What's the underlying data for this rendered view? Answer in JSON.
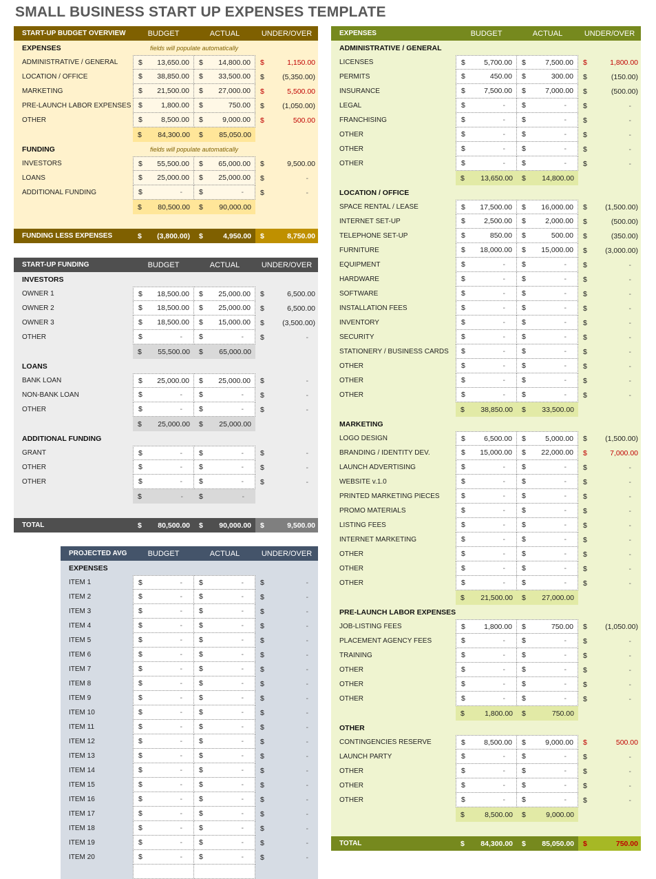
{
  "title": "SMALL BUSINESS START UP EXPENSES TEMPLATE",
  "colors": {
    "overview_header": "#7f6000",
    "overview_bg": "#fff2cc",
    "overview_subtotal": "#ffe699",
    "overview_highlight": "#bf9000",
    "funding_header": "#4f4f4f",
    "funding_bg": "#ededed",
    "funding_subtotal": "#d9d9d9",
    "funding_highlight": "#7f7f7f",
    "projected_header": "#44546a",
    "projected_bg": "#d6dce4",
    "expenses_header": "#76891e",
    "expenses_bg": "#eff4d0",
    "expenses_subtotal": "#e2eaa6",
    "expenses_highlight": "#a6b825",
    "negative_red": "#c00000"
  },
  "columns": {
    "budget": "BUDGET",
    "actual": "ACTUAL",
    "under_over": "UNDER/OVER"
  },
  "overview": {
    "header": "START-UP BUDGET OVERVIEW",
    "note": "fields will populate automatically",
    "expenses_label": "EXPENSES",
    "expenses": [
      {
        "label": "ADMINISTRATIVE / GENERAL",
        "budget": "13,650.00",
        "actual": "14,800.00",
        "diff": "1,150.00",
        "over": true
      },
      {
        "label": "LOCATION / OFFICE",
        "budget": "38,850.00",
        "actual": "33,500.00",
        "diff": "(5,350.00)",
        "over": false
      },
      {
        "label": "MARKETING",
        "budget": "21,500.00",
        "actual": "27,000.00",
        "diff": "5,500.00",
        "over": true
      },
      {
        "label": "PRE-LAUNCH LABOR EXPENSES",
        "budget": "1,800.00",
        "actual": "750.00",
        "diff": "(1,050.00)",
        "over": false
      },
      {
        "label": "OTHER",
        "budget": "8,500.00",
        "actual": "9,000.00",
        "diff": "500.00",
        "over": true
      }
    ],
    "expenses_total": {
      "budget": "84,300.00",
      "actual": "85,050.00"
    },
    "funding_label": "FUNDING",
    "funding": [
      {
        "label": "INVESTORS",
        "budget": "55,500.00",
        "actual": "65,000.00",
        "diff": "9,500.00",
        "over": false
      },
      {
        "label": "LOANS",
        "budget": "25,000.00",
        "actual": "25,000.00",
        "diff": "-",
        "over": false
      },
      {
        "label": "ADDITIONAL FUNDING",
        "budget": "-",
        "actual": "-",
        "diff": "-",
        "over": false
      }
    ],
    "funding_total": {
      "budget": "80,500.00",
      "actual": "90,000.00"
    },
    "footer": {
      "label": "FUNDING LESS EXPENSES",
      "budget": "(3,800.00)",
      "actual": "4,950.00",
      "diff": "8,750.00"
    }
  },
  "startup_funding": {
    "header": "START-UP FUNDING",
    "sections": [
      {
        "label": "INVESTORS",
        "rows": [
          {
            "label": "OWNER 1",
            "budget": "18,500.00",
            "actual": "25,000.00",
            "diff": "6,500.00"
          },
          {
            "label": "OWNER 2",
            "budget": "18,500.00",
            "actual": "25,000.00",
            "diff": "6,500.00"
          },
          {
            "label": "OWNER 3",
            "budget": "18,500.00",
            "actual": "15,000.00",
            "diff": "(3,500.00)"
          },
          {
            "label": "OTHER",
            "budget": "-",
            "actual": "-",
            "diff": "-"
          }
        ],
        "total": {
          "budget": "55,500.00",
          "actual": "65,000.00"
        }
      },
      {
        "label": "LOANS",
        "rows": [
          {
            "label": "BANK LOAN",
            "budget": "25,000.00",
            "actual": "25,000.00",
            "diff": "-"
          },
          {
            "label": "NON-BANK LOAN",
            "budget": "-",
            "actual": "-",
            "diff": "-"
          },
          {
            "label": "OTHER",
            "budget": "-",
            "actual": "-",
            "diff": "-"
          }
        ],
        "total": {
          "budget": "25,000.00",
          "actual": "25,000.00"
        }
      },
      {
        "label": "ADDITIONAL FUNDING",
        "rows": [
          {
            "label": "GRANT",
            "budget": "-",
            "actual": "-",
            "diff": "-"
          },
          {
            "label": "OTHER",
            "budget": "-",
            "actual": "-",
            "diff": "-"
          },
          {
            "label": "OTHER",
            "budget": "-",
            "actual": "-",
            "diff": "-"
          }
        ],
        "total": {
          "budget": "-",
          "actual": "-"
        }
      }
    ],
    "footer": {
      "label": "TOTAL",
      "budget": "80,500.00",
      "actual": "90,000.00",
      "diff": "9,500.00"
    }
  },
  "projected": {
    "header": "PROJECTED AVG",
    "expenses_label": "EXPENSES",
    "items": [
      "ITEM 1",
      "ITEM 2",
      "ITEM 3",
      "ITEM 4",
      "ITEM 5",
      "ITEM 6",
      "ITEM 7",
      "ITEM 8",
      "ITEM 9",
      "ITEM 10",
      "ITEM 11",
      "ITEM 12",
      "ITEM 13",
      "ITEM 14",
      "ITEM 15",
      "ITEM 16",
      "ITEM 17",
      "ITEM 18",
      "ITEM 19",
      "ITEM 20"
    ],
    "empty_value": "-"
  },
  "expenses": {
    "header": "EXPENSES",
    "sections": [
      {
        "label": "ADMINISTRATIVE / GENERAL",
        "rows": [
          {
            "label": "LICENSES",
            "budget": "5,700.00",
            "actual": "7,500.00",
            "diff": "1,800.00",
            "over": true
          },
          {
            "label": "PERMITS",
            "budget": "450.00",
            "actual": "300.00",
            "diff": "(150.00)"
          },
          {
            "label": "INSURANCE",
            "budget": "7,500.00",
            "actual": "7,000.00",
            "diff": "(500.00)"
          },
          {
            "label": "LEGAL",
            "budget": "-",
            "actual": "-",
            "diff": "-"
          },
          {
            "label": "FRANCHISING",
            "budget": "-",
            "actual": "-",
            "diff": "-"
          },
          {
            "label": "OTHER",
            "budget": "-",
            "actual": "-",
            "diff": "-"
          },
          {
            "label": "OTHER",
            "budget": "-",
            "actual": "-",
            "diff": "-"
          },
          {
            "label": "OTHER",
            "budget": "-",
            "actual": "-",
            "diff": "-"
          }
        ],
        "total": {
          "budget": "13,650.00",
          "actual": "14,800.00"
        }
      },
      {
        "label": "LOCATION / OFFICE",
        "rows": [
          {
            "label": "SPACE RENTAL / LEASE",
            "budget": "17,500.00",
            "actual": "16,000.00",
            "diff": "(1,500.00)"
          },
          {
            "label": "INTERNET SET-UP",
            "budget": "2,500.00",
            "actual": "2,000.00",
            "diff": "(500.00)"
          },
          {
            "label": "TELEPHONE SET-UP",
            "budget": "850.00",
            "actual": "500.00",
            "diff": "(350.00)"
          },
          {
            "label": "FURNITURE",
            "budget": "18,000.00",
            "actual": "15,000.00",
            "diff": "(3,000.00)"
          },
          {
            "label": "EQUIPMENT",
            "budget": "-",
            "actual": "-",
            "diff": "-"
          },
          {
            "label": "HARDWARE",
            "budget": "-",
            "actual": "-",
            "diff": "-"
          },
          {
            "label": "SOFTWARE",
            "budget": "-",
            "actual": "-",
            "diff": "-"
          },
          {
            "label": "INSTALLATION FEES",
            "budget": "-",
            "actual": "-",
            "diff": "-"
          },
          {
            "label": "INVENTORY",
            "budget": "-",
            "actual": "-",
            "diff": "-"
          },
          {
            "label": "SECURITY",
            "budget": "-",
            "actual": "-",
            "diff": "-"
          },
          {
            "label": "STATIONERY / BUSINESS CARDS",
            "budget": "-",
            "actual": "-",
            "diff": "-"
          },
          {
            "label": "OTHER",
            "budget": "-",
            "actual": "-",
            "diff": "-"
          },
          {
            "label": "OTHER",
            "budget": "-",
            "actual": "-",
            "diff": "-"
          },
          {
            "label": "OTHER",
            "budget": "-",
            "actual": "-",
            "diff": "-"
          }
        ],
        "total": {
          "budget": "38,850.00",
          "actual": "33,500.00"
        }
      },
      {
        "label": "MARKETING",
        "rows": [
          {
            "label": "LOGO DESIGN",
            "budget": "6,500.00",
            "actual": "5,000.00",
            "diff": "(1,500.00)"
          },
          {
            "label": "BRANDING / IDENTITY DEV.",
            "budget": "15,000.00",
            "actual": "22,000.00",
            "diff": "7,000.00",
            "over": true
          },
          {
            "label": "LAUNCH ADVERTISING",
            "budget": "-",
            "actual": "-",
            "diff": "-"
          },
          {
            "label": "WEBSITE v.1.0",
            "budget": "-",
            "actual": "-",
            "diff": "-"
          },
          {
            "label": "PRINTED MARKETING PIECES",
            "budget": "-",
            "actual": "-",
            "diff": "-"
          },
          {
            "label": "PROMO MATERIALS",
            "budget": "-",
            "actual": "-",
            "diff": "-"
          },
          {
            "label": "LISTING FEES",
            "budget": "-",
            "actual": "-",
            "diff": "-"
          },
          {
            "label": "INTERNET MARKETING",
            "budget": "-",
            "actual": "-",
            "diff": "-"
          },
          {
            "label": "OTHER",
            "budget": "-",
            "actual": "-",
            "diff": "-"
          },
          {
            "label": "OTHER",
            "budget": "-",
            "actual": "-",
            "diff": "-"
          },
          {
            "label": "OTHER",
            "budget": "-",
            "actual": "-",
            "diff": "-"
          }
        ],
        "total": {
          "budget": "21,500.00",
          "actual": "27,000.00"
        }
      },
      {
        "label": "PRE-LAUNCH LABOR EXPENSES",
        "rows": [
          {
            "label": "JOB-LISTING FEES",
            "budget": "1,800.00",
            "actual": "750.00",
            "diff": "(1,050.00)"
          },
          {
            "label": "PLACEMENT AGENCY FEES",
            "budget": "-",
            "actual": "-",
            "diff": "-"
          },
          {
            "label": "TRAINING",
            "budget": "-",
            "actual": "-",
            "diff": "-"
          },
          {
            "label": "OTHER",
            "budget": "-",
            "actual": "-",
            "diff": "-"
          },
          {
            "label": "OTHER",
            "budget": "-",
            "actual": "-",
            "diff": "-"
          },
          {
            "label": "OTHER",
            "budget": "-",
            "actual": "-",
            "diff": "-"
          }
        ],
        "total": {
          "budget": "1,800.00",
          "actual": "750.00"
        }
      },
      {
        "label": "OTHER",
        "rows": [
          {
            "label": "CONTINGENCIES RESERVE",
            "budget": "8,500.00",
            "actual": "9,000.00",
            "diff": "500.00",
            "over": true
          },
          {
            "label": "LAUNCH PARTY",
            "budget": "-",
            "actual": "-",
            "diff": "-"
          },
          {
            "label": "OTHER",
            "budget": "-",
            "actual": "-",
            "diff": "-"
          },
          {
            "label": "OTHER",
            "budget": "-",
            "actual": "-",
            "diff": "-"
          },
          {
            "label": "OTHER",
            "budget": "-",
            "actual": "-",
            "diff": "-"
          }
        ],
        "total": {
          "budget": "8,500.00",
          "actual": "9,000.00"
        }
      }
    ],
    "footer": {
      "label": "TOTAL",
      "budget": "84,300.00",
      "actual": "85,050.00",
      "diff": "750.00",
      "over": true
    }
  },
  "currency_symbol": "$"
}
